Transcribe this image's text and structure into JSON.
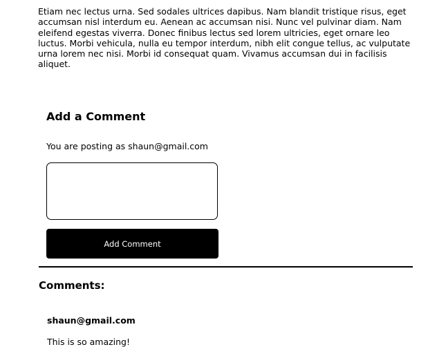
{
  "article": {
    "body": "Etiam nec lectus urna. Sed sodales ultrices dapibus. Nam blandit tristique risus, eget accumsan nisl interdum eu. Aenean ac accumsan nisi. Nunc vel pulvinar diam. Nam eleifend egestas viverra. Donec finibus lectus sed lorem ultricies, eget ornare leo luctus. Morbi vehicula, nulla eu tempor interdum, nibh elit congue tellus, ac vulputate urna lorem nec nisi. Morbi id consequat quam. Vivamus accumsan dui in facilisis aliquet."
  },
  "comment_form": {
    "heading": "Add a Comment",
    "posting_as": "You are posting as shaun@gmail.com",
    "textarea_value": "",
    "submit_label": "Add Comment"
  },
  "comments": {
    "heading": "Comments:",
    "items": [
      {
        "author": "shaun@gmail.com",
        "body": "This is so amazing!"
      }
    ]
  }
}
